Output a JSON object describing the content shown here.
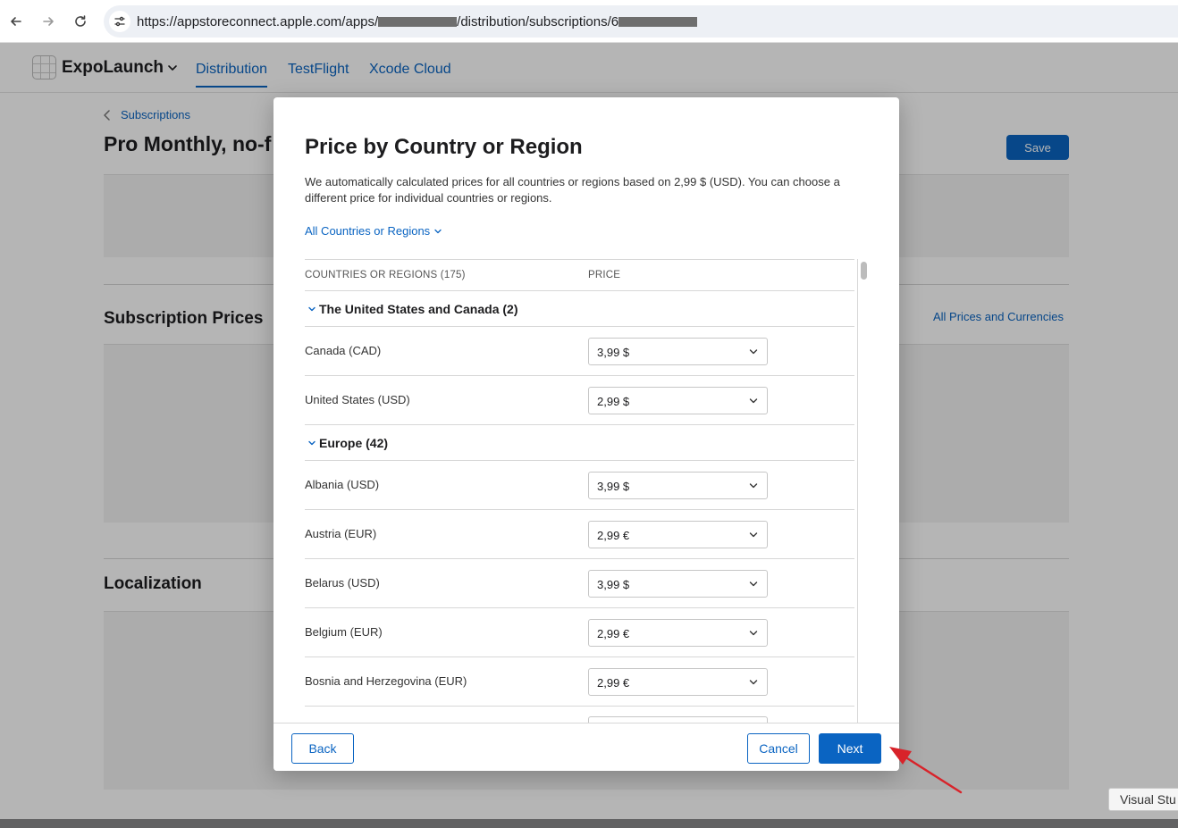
{
  "browser": {
    "url_prefix": "https://appstoreconnect.apple.com/apps/",
    "url_middle": "/distribution/subscriptions/6"
  },
  "app": {
    "name": "ExpoLaunch",
    "tabs": [
      {
        "label": "Distribution",
        "active": true
      },
      {
        "label": "TestFlight",
        "active": false
      },
      {
        "label": "Xcode Cloud",
        "active": false
      }
    ]
  },
  "page": {
    "breadcrumb": "Subscriptions",
    "title": "Pro Monthly, no-f",
    "save_label": "Save",
    "subscription_prices_title": "Subscription Prices",
    "all_prices_link": "All Prices and Currencies",
    "localization_title": "Localization"
  },
  "modal": {
    "title": "Price by Country or Region",
    "description": "We automatically calculated prices for all countries or regions based on 2,99 $ (USD). You can choose a different price for individual countries or regions.",
    "filter_label": "All Countries or Regions",
    "columns": {
      "country": "COUNTRIES OR REGIONS (175)",
      "price": "PRICE"
    },
    "groups": [
      {
        "label": "The United States and Canada (2)",
        "rows": [
          {
            "country": "Canada (CAD)",
            "price": "3,99 $"
          },
          {
            "country": "United States (USD)",
            "price": "2,99 $"
          }
        ]
      },
      {
        "label": "Europe (42)",
        "rows": [
          {
            "country": "Albania (USD)",
            "price": "3,99 $"
          },
          {
            "country": "Austria (EUR)",
            "price": "2,99 €"
          },
          {
            "country": "Belarus (USD)",
            "price": "3,99 $"
          },
          {
            "country": "Belgium (EUR)",
            "price": "2,99 €"
          },
          {
            "country": "Bosnia and Herzegovina (EUR)",
            "price": "2,99 €"
          }
        ]
      }
    ],
    "back_label": "Back",
    "cancel_label": "Cancel",
    "next_label": "Next"
  },
  "taskbar_tooltip": "Visual Stu",
  "colors": {
    "accent": "#0a64c2",
    "annotation_arrow": "#d8232a"
  }
}
